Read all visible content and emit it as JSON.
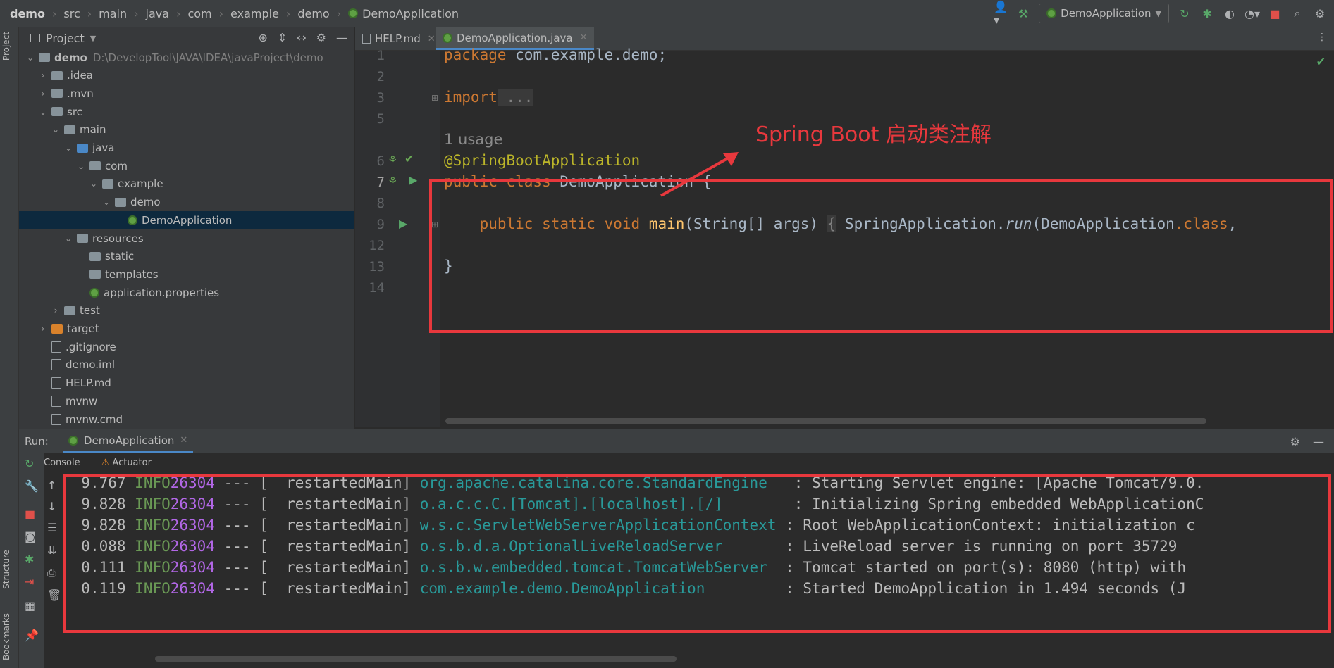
{
  "navbar": {
    "crumbs": [
      "demo",
      "src",
      "main",
      "java",
      "com",
      "example",
      "demo",
      "DemoApplication"
    ],
    "run_config": "DemoApplication"
  },
  "left_strip": {
    "project_tab": "Project",
    "structure_tab": "Structure",
    "bookmarks_tab": "Bookmarks"
  },
  "project": {
    "title": "Project",
    "tree": [
      {
        "label": "demo",
        "path": "D:\\DevelopTool\\JAVA\\IDEA\\javaProject\\demo",
        "depth": 0,
        "arrow": "open",
        "icon": "folder"
      },
      {
        "label": ".idea",
        "depth": 1,
        "arrow": "closed",
        "icon": "folder"
      },
      {
        "label": ".mvn",
        "depth": 1,
        "arrow": "closed",
        "icon": "folder"
      },
      {
        "label": "src",
        "depth": 1,
        "arrow": "open",
        "icon": "folder"
      },
      {
        "label": "main",
        "depth": 2,
        "arrow": "open",
        "icon": "folder"
      },
      {
        "label": "java",
        "depth": 3,
        "arrow": "open",
        "icon": "folder-blue"
      },
      {
        "label": "com",
        "depth": 4,
        "arrow": "open",
        "icon": "folder"
      },
      {
        "label": "example",
        "depth": 5,
        "arrow": "open",
        "icon": "folder"
      },
      {
        "label": "demo",
        "depth": 6,
        "arrow": "open",
        "icon": "folder"
      },
      {
        "label": "DemoApplication",
        "depth": 7,
        "arrow": "none",
        "icon": "spring",
        "selected": true
      },
      {
        "label": "resources",
        "depth": 3,
        "arrow": "open",
        "icon": "folder"
      },
      {
        "label": "static",
        "depth": 4,
        "arrow": "none",
        "icon": "folder"
      },
      {
        "label": "templates",
        "depth": 4,
        "arrow": "none",
        "icon": "folder"
      },
      {
        "label": "application.properties",
        "depth": 4,
        "arrow": "none",
        "icon": "spring"
      },
      {
        "label": "test",
        "depth": 2,
        "arrow": "closed",
        "icon": "folder"
      },
      {
        "label": "target",
        "depth": 1,
        "arrow": "closed",
        "icon": "folder-orange"
      },
      {
        "label": ".gitignore",
        "depth": 1,
        "arrow": "none",
        "icon": "file"
      },
      {
        "label": "demo.iml",
        "depth": 1,
        "arrow": "none",
        "icon": "file"
      },
      {
        "label": "HELP.md",
        "depth": 1,
        "arrow": "none",
        "icon": "file"
      },
      {
        "label": "mvnw",
        "depth": 1,
        "arrow": "none",
        "icon": "file"
      },
      {
        "label": "mvnw.cmd",
        "depth": 1,
        "arrow": "none",
        "icon": "file"
      }
    ]
  },
  "editor": {
    "tabs": [
      {
        "label": "HELP.md",
        "active": false
      },
      {
        "label": "DemoApplication.java",
        "active": true
      }
    ],
    "line_numbers": [
      "1",
      "2",
      "3",
      "5",
      "6",
      "7",
      "8",
      "9",
      "12",
      "13",
      "14"
    ],
    "usage_hint": "1 usage",
    "code": {
      "l1_kw": "package",
      "l1_rest": " com.example.demo;",
      "l3_kw": "import",
      "l3_fold": " ...",
      "l6_ann": "@SpringBootApplication",
      "l7_kw": "public class",
      "l7_name": " DemoApplication",
      "l7_rest": " {",
      "l9_indent": "    ",
      "l9_kw": "public static void",
      "l9_fn": " main",
      "l9_params": "(String[] args) ",
      "l9_fold_open": "{",
      "l9_call": " SpringApplication.",
      "l9_run": "run",
      "l9_arg": "(DemoApplication",
      "l9_class": ".class",
      "l9_tail": ",",
      "l13": "}"
    }
  },
  "annotation": "Spring Boot 启动类注解",
  "run_panel": {
    "label": "Run:",
    "tab": "DemoApplication",
    "subtabs": [
      "Console",
      "Actuator"
    ],
    "log": [
      {
        "time": "9.767",
        "level": "INFO",
        "pid": "26304",
        "sep": " --- [  restartedMain] ",
        "logger": "org.apache.catalina.core.StandardEngine  ",
        "msg": " : Starting Servlet engine: [Apache Tomcat/9.0."
      },
      {
        "time": "9.828",
        "level": "INFO",
        "pid": "26304",
        "sep": " --- [  restartedMain] ",
        "logger": "o.a.c.c.C.[Tomcat].[localhost].[/]       ",
        "msg": " : Initializing Spring embedded WebApplicationC"
      },
      {
        "time": "9.828",
        "level": "INFO",
        "pid": "26304",
        "sep": " --- [  restartedMain] ",
        "logger": "w.s.c.ServletWebServerApplicationContext",
        "msg": " : Root WebApplicationContext: initialization c"
      },
      {
        "time": "0.088",
        "level": "INFO",
        "pid": "26304",
        "sep": " --- [  restartedMain] ",
        "logger": "o.s.b.d.a.OptionalLiveReloadServer      ",
        "msg": " : LiveReload server is running on port 35729"
      },
      {
        "time": "0.111",
        "level": "INFO",
        "pid": "26304",
        "sep": " --- [  restartedMain] ",
        "logger": "o.s.b.w.embedded.tomcat.TomcatWebServer ",
        "msg": " : Tomcat started on port(s): 8080 (http) with"
      },
      {
        "time": "0.119",
        "level": "INFO",
        "pid": "26304",
        "sep": " --- [  restartedMain] ",
        "logger": "com.example.demo.DemoApplication        ",
        "msg": " : Started DemoApplication in 1.494 seconds (J"
      }
    ]
  },
  "colors": {
    "annotation_red": "#e8383d",
    "keyword": "#cc7832",
    "annotation_yellow": "#bbb529",
    "method": "#ffc66d",
    "logger": "#299999",
    "pid": "#b267e6",
    "info": "#6a9955"
  }
}
